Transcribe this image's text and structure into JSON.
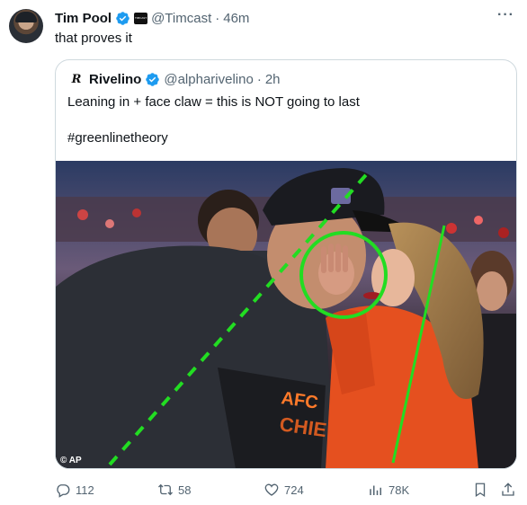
{
  "tweet": {
    "author_name": "Tim Pool",
    "author_handle": "@Timcast",
    "separator": "·",
    "time": "46m",
    "text": "that proves it",
    "affiliate_badge": "TIMCAST",
    "more_label": "···"
  },
  "quote": {
    "author_name": "Rivelino",
    "author_handle": "@alpharivelino",
    "separator": "·",
    "time": "2h",
    "line1": "Leaning in + face claw = this is NOT going to last",
    "line2": "#greenlinetheory",
    "photo_credit": "© AP"
  },
  "actions": {
    "replies": "112",
    "reposts": "58",
    "likes": "724",
    "views": "78K"
  },
  "colors": {
    "verified": "#1d9bf0",
    "annotation_green": "#22dd22",
    "muted": "#536471",
    "border": "#cfd9de"
  },
  "icons": [
    "verified-badge-icon",
    "reply-icon",
    "repost-icon",
    "like-icon",
    "views-icon",
    "bookmark-icon",
    "share-icon",
    "more-icon"
  ]
}
